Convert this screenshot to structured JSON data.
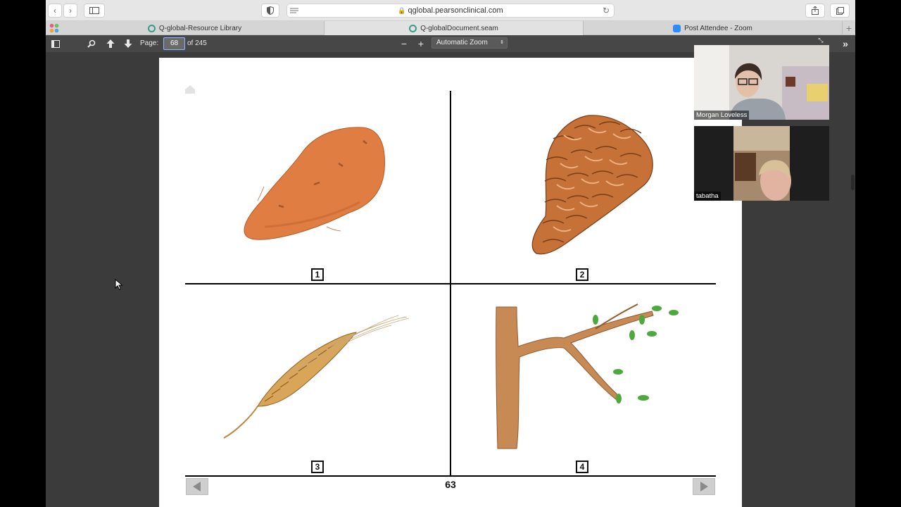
{
  "browser": {
    "url": "qglobal.pearsonclinical.com",
    "tabs": [
      {
        "label": "Q-global-Resource Library",
        "icon": "qglobal-icon"
      },
      {
        "label": "Q-globalDocument.seam",
        "icon": "qglobal-icon"
      },
      {
        "label": "Post Attendee - Zoom",
        "icon": "zoom-icon"
      }
    ]
  },
  "pdf_toolbar": {
    "page_label": "Page:",
    "page_value": "68",
    "page_total": "of 245",
    "zoom_option": "Automatic Zoom"
  },
  "document": {
    "items": [
      {
        "number": "1",
        "picture": "sweet potato"
      },
      {
        "number": "2",
        "picture": "pine cone"
      },
      {
        "number": "3",
        "picture": "wheat"
      },
      {
        "number": "4",
        "picture": "tree branch"
      }
    ],
    "page_number": "63"
  },
  "zoom": {
    "participants": [
      {
        "name": "Morgan Loveless"
      },
      {
        "name": "tabatha"
      }
    ]
  },
  "colors": {
    "viewer_bg": "#3b3b3b",
    "toolbar_bg": "#474747",
    "page_bg": "#ffffff"
  }
}
